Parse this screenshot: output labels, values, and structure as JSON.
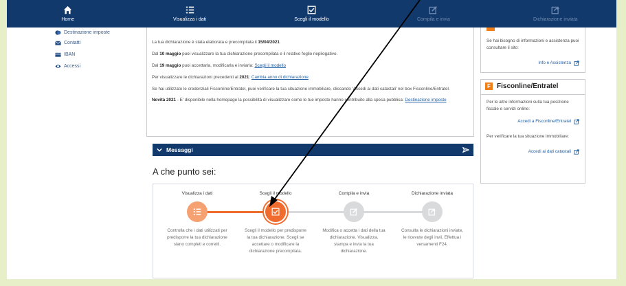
{
  "nav": [
    {
      "label": "Home",
      "icon": "home-icon",
      "active": true
    },
    {
      "label": "Visualizza i dati",
      "icon": "list-icon",
      "active": true
    },
    {
      "label": "Scegli il modello",
      "icon": "checkbox-icon",
      "active": true
    },
    {
      "label": "Compila e invia",
      "icon": "edit-icon",
      "active": false
    },
    {
      "label": "Dichiarazione inviata",
      "icon": "share-icon",
      "active": false
    }
  ],
  "sidebar": {
    "items": [
      {
        "label": "Destinazione imposte",
        "icon": "coins-icon"
      },
      {
        "label": "Contatti",
        "icon": "envelope-icon"
      },
      {
        "label": "IBAN",
        "icon": "card-icon"
      },
      {
        "label": "Accessi",
        "icon": "eye-icon"
      }
    ]
  },
  "info": {
    "p1_pre": "La tua dichiarazione è stata elaborata e precompilata il ",
    "p1_bold": "15/04/2021",
    "p1_post": ".",
    "p2_pre": "Dal ",
    "p2_bold": "10 maggio",
    "p2_post": " puoi visualizzare la tua dichiarazione precompilata e il relativo foglio riepilogativo.",
    "p3_pre": "Dal ",
    "p3_bold": "19 maggio",
    "p3_post": " puoi accettarla, modificarla e inviarla: ",
    "p3_link": "Scegli il modello",
    "p4_pre": "Per visualizzare le dichiarazioni precedenti al ",
    "p4_bold": "2021",
    "p4_post": ": ",
    "p4_link": "Cambia anno di dichiarazione",
    "p5": "Se hai utilizzato le credenziali Fisconline/Entratel, puoi verificare la tua situazione immobiliare, cliccando 'Accedi ai dati catastali' nel box Fisconline/Entratel.",
    "p6_bold": "Novità 2021",
    "p6_post": " - E' disponibile nella homepage la possibilità di visualizzare come le tue imposte hanno contribuito alla spesa pubblica: ",
    "p6_link": "Destinazione imposte"
  },
  "messages": {
    "label": "Messaggi"
  },
  "progress": {
    "heading": "A che punto sei:",
    "current_step": 2,
    "steps": [
      {
        "title": "Visualizza i dati",
        "status": "done",
        "desc": "Controlla che i dati utilizzati per predisporre la tua dichiarazione siano completi e corretti."
      },
      {
        "title": "Scegli il modello",
        "status": "current",
        "desc": "Scegli il modello per predisporre la tua dichiarazione. Scegli se accettare o modificare la dichiarazione precompilata."
      },
      {
        "title": "Compila e invia",
        "status": "todo",
        "desc": "Modifica o accetta i dati della tua dichiarazione. Visualizza, stampa e invia la tua dichiarazione."
      },
      {
        "title": "Dichiarazione inviata",
        "status": "todo",
        "desc": "Consulta le dichiarazioni inviate, le ricevute degli invii. Effettua i versamenti F24."
      }
    ]
  },
  "right": {
    "help_text": "Se hai bisogno di informazioni e assistenza puoi consultare il sito:",
    "help_link": "Info e Assistenza",
    "fisco_title": "Fisconline/Entratel",
    "fisco_icon_letter": "F",
    "fisco_text1": "Per le altre informazioni sulla tua posizione fiscale e servizi online:",
    "fisco_link1": "Accedi a Fisconline/Entratel",
    "fisco_text2": "Per verificare la tua situazione immobiliare:",
    "fisco_link2": "Accedi ai dati catastali"
  },
  "colors": {
    "nav_bg": "#12396b",
    "accent": "#ef6c2e",
    "link": "#1f5fa6"
  }
}
